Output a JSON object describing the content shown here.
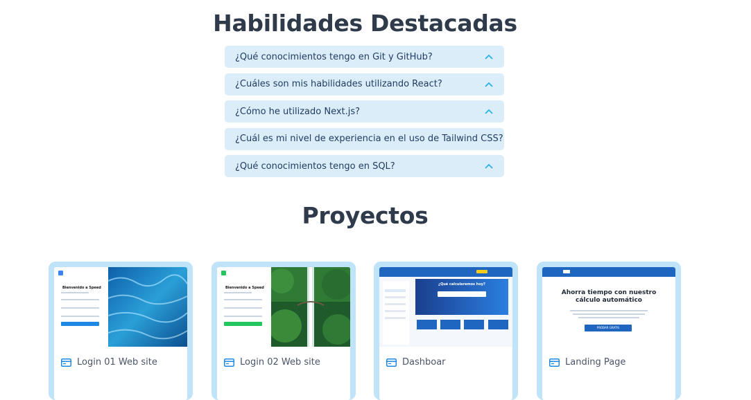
{
  "skills_title": "Habilidades Destacadas",
  "faq": [
    {
      "q": "¿Qué conocimientos tengo en Git y GitHub?"
    },
    {
      "q": "¿Cuáles son mis habilidades utilizando React?"
    },
    {
      "q": "¿Cómo he utilizado Next.js?"
    },
    {
      "q": "¿Cuál es mi nivel de experiencia en el uso de Tailwind CSS?"
    },
    {
      "q": "¿Qué conocimientos tengo en SQL?"
    }
  ],
  "projects_title": "Proyectos",
  "projects": [
    {
      "label": "Login 01 Web site",
      "mock_title": "Bienvenido a Speed",
      "thumb_icon": "water-photo"
    },
    {
      "label": "Login 02 Web site",
      "mock_title": "Bienvenido a Speed",
      "thumb_icon": "waterfall-photo"
    },
    {
      "label": "Dashboar",
      "mock_title": "¿Qué calcularemos hoy?",
      "thumb_icon": "dashboard-screenshot"
    },
    {
      "label": "Landing Page",
      "mock_title": "Ahorra tiempo con nuestro cálculo automático",
      "mock_button": "PROBAR GRATIS",
      "thumb_icon": "landing-screenshot"
    }
  ],
  "colors": {
    "accent": "#1e88e5",
    "faq_bg": "#dcedfa",
    "card_border": "#bfe3f9",
    "chevron": "#2bb3e6"
  }
}
